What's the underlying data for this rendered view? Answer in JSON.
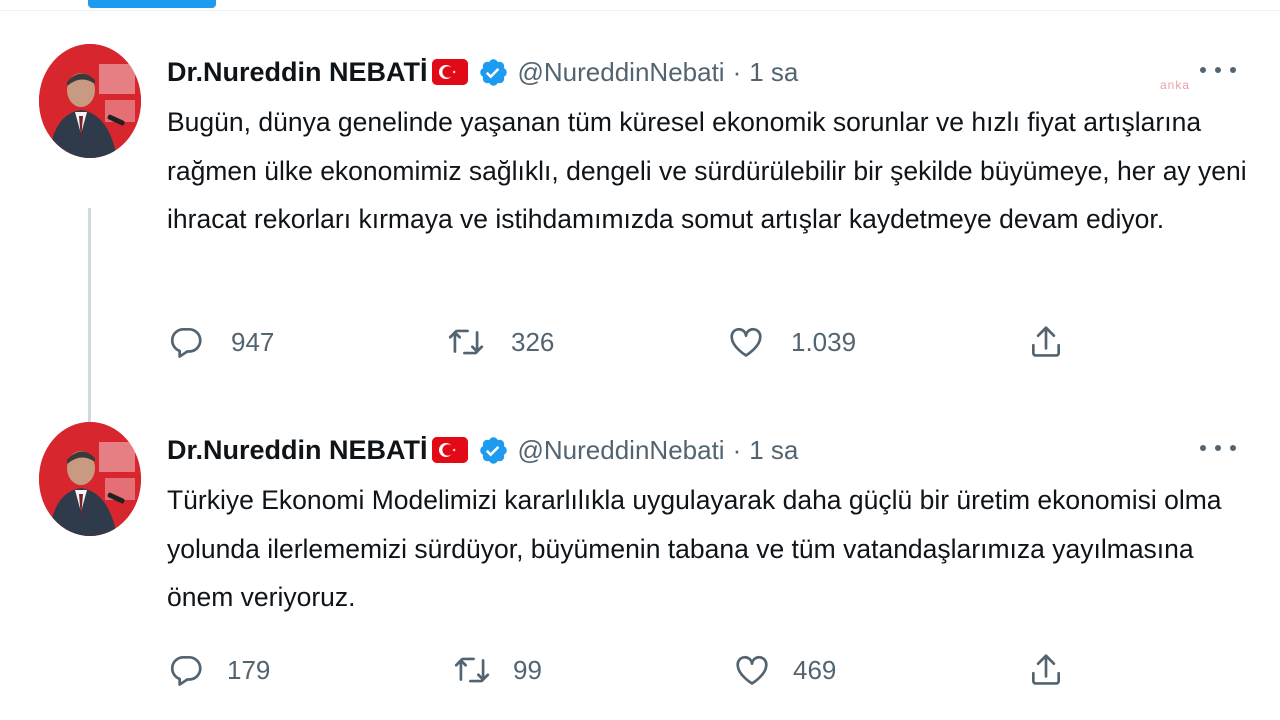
{
  "tweets": [
    {
      "author": {
        "display_name": "Dr.Nureddin NEBATİ",
        "handle": "@NureddinNebati"
      },
      "separator": "·",
      "time": "1 sa",
      "watermark": "anka",
      "text": "Bugün, dünya genelinde yaşanan tüm küresel ekonomik sorunlar ve hızlı fiyat artışlarına rağmen ülke ekonomimiz sağlıklı, dengeli ve sürdürülebilir bir şekilde büyümeye, her ay yeni ihracat rekorları kırmaya ve istihdamımızda somut artışlar kaydetmeye devam ediyor.",
      "counts": {
        "replies": "947",
        "retweets": "326",
        "likes": "1.039"
      }
    },
    {
      "author": {
        "display_name": "Dr.Nureddin NEBATİ",
        "handle": "@NureddinNebati"
      },
      "separator": "·",
      "time": "1 sa",
      "text": "Türkiye Ekonomi Modelimizi kararlılıkla uygulayarak daha güçlü bir üretim ekonomisi olma yolunda ilerlememizi sürdüyor, büyümenin tabana ve tüm vatandaşlarımıza yayılmasına önem veriyoruz.",
      "counts": {
        "replies": "179",
        "retweets": "99",
        "likes": "469"
      }
    }
  ],
  "icons": {
    "reply": "reply-icon",
    "retweet": "retweet-icon",
    "like": "heart-icon",
    "share": "share-icon",
    "verified": "verified-badge-icon",
    "flag": "turkey-flag-icon",
    "more": "more-options-icon"
  },
  "colors": {
    "accent": "#1d9bf0",
    "text": "#0f1419",
    "secondary": "#536471",
    "flag_red": "#e30a17"
  }
}
